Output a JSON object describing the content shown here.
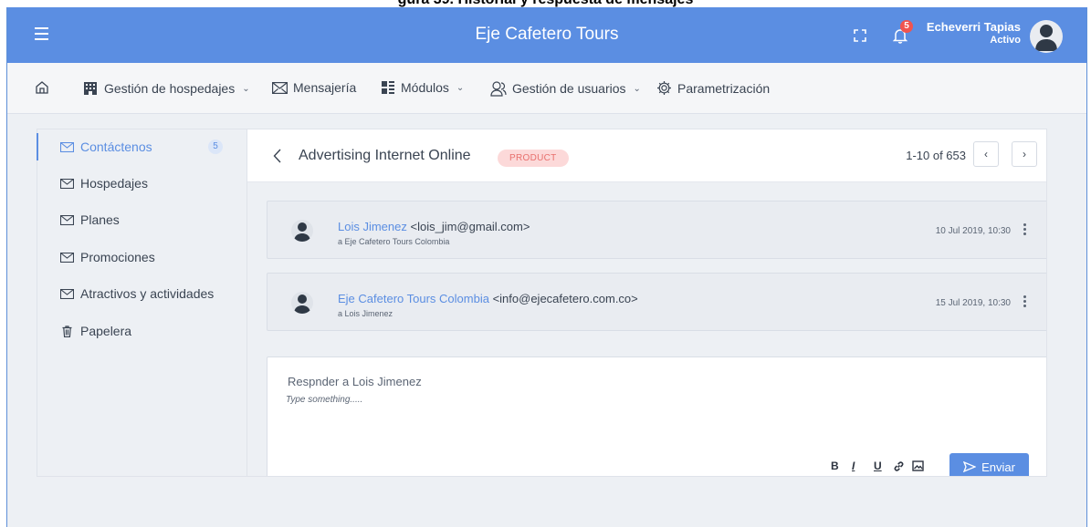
{
  "document_caption": "gura 39. Historial y respuesta de mensajes",
  "app": {
    "title": "Eje Cafetero Tours",
    "notification_count": "5",
    "user": {
      "name": "Echeverri Tapias",
      "status": "Activo"
    },
    "accent_color": "#5b8ee2"
  },
  "menu": {
    "home_icon": "home-icon",
    "items": [
      {
        "label": "Gestión de hospedajes",
        "icon": "building-icon",
        "has_dropdown": true
      },
      {
        "label": "Mensajería",
        "icon": "mail-icon",
        "has_dropdown": false
      },
      {
        "label": "Módulos",
        "icon": "modules-icon",
        "has_dropdown": true
      },
      {
        "label": "Gestión de usuarios",
        "icon": "users-icon",
        "has_dropdown": true
      },
      {
        "label": "Parametrización",
        "icon": "gear-icon",
        "has_dropdown": false
      }
    ]
  },
  "sidebar": {
    "items": [
      {
        "label": "Contáctenos",
        "icon": "mail-icon",
        "badge": "5",
        "active": true
      },
      {
        "label": "Hospedajes",
        "icon": "mail-icon"
      },
      {
        "label": "Planes",
        "icon": "mail-icon"
      },
      {
        "label": "Promociones",
        "icon": "mail-icon"
      },
      {
        "label": "Atractivos y actividades",
        "icon": "mail-icon"
      },
      {
        "label": "Papelera",
        "icon": "trash-icon"
      }
    ]
  },
  "thread": {
    "subject": "Advertising Internet Online",
    "tag": "PRODUCT",
    "pagination": "1-10 of 653",
    "messages": [
      {
        "sender": "Lois Jimenez",
        "email": "<lois_jim@gmail.com>",
        "to": "a Eje Cafetero Tours Colombia",
        "date": "10 Jul 2019, 10:30"
      },
      {
        "sender": "Eje Cafetero Tours Colombia",
        "email": "<info@ejecafetero.com.co>",
        "to": "a Lois Jimenez",
        "date": "15 Jul 2019, 10:30"
      }
    ]
  },
  "reply": {
    "title": "Respnder a Lois Jimenez",
    "placeholder": "Type something.....",
    "format_buttons": {
      "bold": "B",
      "italic": "I",
      "underline": "U"
    },
    "send_label": "Enviar"
  }
}
